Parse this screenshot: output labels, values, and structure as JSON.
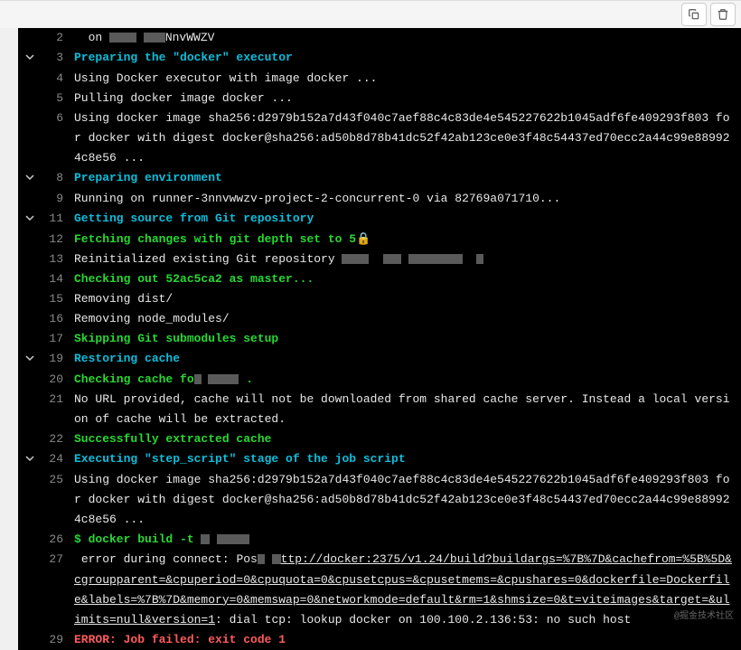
{
  "toolbar": {
    "copy_icon": "copy",
    "delete_icon": "delete"
  },
  "lines": [
    {
      "num": "2",
      "chevron": false,
      "segments": [
        {
          "text": "  on ",
          "cls": "white"
        },
        {
          "redacted": 30
        },
        {
          "text": " ",
          "cls": ""
        },
        {
          "redacted": 24
        },
        {
          "text": "NnvWWZV",
          "cls": "white"
        }
      ]
    },
    {
      "num": "3",
      "chevron": true,
      "segments": [
        {
          "text": "Preparing the \"docker\" executor",
          "cls": "cyan"
        }
      ]
    },
    {
      "num": "4",
      "chevron": false,
      "segments": [
        {
          "text": "Using Docker executor with image docker ...",
          "cls": "white"
        }
      ]
    },
    {
      "num": "5",
      "chevron": false,
      "segments": [
        {
          "text": "Pulling docker image docker ...",
          "cls": "white"
        }
      ]
    },
    {
      "num": "6",
      "chevron": false,
      "segments": [
        {
          "text": "Using docker image sha256:d2979b152a7d43f040c7aef88c4c83de4e545227622b1045adf6fe409293f803 for docker with digest docker@sha256:ad50b8d78b41dc52f42ab123ce0e3f48c54437ed70ecc2a44c99e889924c8e56 ...",
          "cls": "white"
        }
      ]
    },
    {
      "num": "8",
      "chevron": true,
      "segments": [
        {
          "text": "Preparing environment",
          "cls": "cyan"
        }
      ]
    },
    {
      "num": "9",
      "chevron": false,
      "segments": [
        {
          "text": "Running on runner-3nnvwwzv-project-2-concurrent-0 via 82769a071710...",
          "cls": "white"
        }
      ]
    },
    {
      "num": "11",
      "chevron": true,
      "segments": [
        {
          "text": "Getting source from Git repository",
          "cls": "cyan"
        }
      ]
    },
    {
      "num": "12",
      "chevron": false,
      "segments": [
        {
          "text": "Fetching changes with git depth set to 5",
          "cls": "green"
        },
        {
          "text": "🔒",
          "cls": "green"
        }
      ]
    },
    {
      "num": "13",
      "chevron": false,
      "segments": [
        {
          "text": "Reinitialized existing Git repository ",
          "cls": "white"
        },
        {
          "redacted": 30
        },
        {
          "text": "  ",
          "cls": ""
        },
        {
          "redacted": 20
        },
        {
          "text": " ",
          "cls": ""
        },
        {
          "redacted": 60
        },
        {
          "text": "  ",
          "cls": ""
        },
        {
          "redacted": 8
        }
      ]
    },
    {
      "num": "14",
      "chevron": false,
      "segments": [
        {
          "text": "Checking out 52ac5ca2 as master...",
          "cls": "green"
        }
      ]
    },
    {
      "num": "15",
      "chevron": false,
      "segments": [
        {
          "text": "Removing dist/",
          "cls": "white"
        }
      ]
    },
    {
      "num": "16",
      "chevron": false,
      "segments": [
        {
          "text": "Removing node_modules/",
          "cls": "white"
        }
      ]
    },
    {
      "num": "17",
      "chevron": false,
      "segments": [
        {
          "text": "Skipping Git submodules setup",
          "cls": "green"
        }
      ]
    },
    {
      "num": "19",
      "chevron": true,
      "segments": [
        {
          "text": "Restoring cache",
          "cls": "cyan"
        }
      ]
    },
    {
      "num": "20",
      "chevron": false,
      "segments": [
        {
          "text": "Checking cache fo",
          "cls": "green"
        },
        {
          "redacted": 8
        },
        {
          "text": " ",
          "cls": ""
        },
        {
          "redacted": 34
        },
        {
          "text": " .",
          "cls": "green"
        }
      ]
    },
    {
      "num": "21",
      "chevron": false,
      "segments": [
        {
          "text": "No URL provided, cache will not be downloaded from shared cache server. Instead a local version of cache will be extracted.",
          "cls": "white"
        }
      ]
    },
    {
      "num": "22",
      "chevron": false,
      "segments": [
        {
          "text": "Successfully extracted cache",
          "cls": "green"
        }
      ]
    },
    {
      "num": "24",
      "chevron": true,
      "segments": [
        {
          "text": "Executing \"step_script\" stage of the job script",
          "cls": "cyan"
        }
      ]
    },
    {
      "num": "25",
      "chevron": false,
      "segments": [
        {
          "text": "Using docker image sha256:d2979b152a7d43f040c7aef88c4c83de4e545227622b1045adf6fe409293f803 for docker with digest docker@sha256:ad50b8d78b41dc52f42ab123ce0e3f48c54437ed70ecc2a44c99e889924c8e56 ...",
          "cls": "white"
        }
      ]
    },
    {
      "num": "26",
      "chevron": false,
      "segments": [
        {
          "text": "$ docker build -t ",
          "cls": "green"
        },
        {
          "redacted": 10
        },
        {
          "text": " ",
          "cls": ""
        },
        {
          "redacted": 36
        }
      ]
    },
    {
      "num": "27",
      "chevron": false,
      "segments": [
        {
          "text": " error during connect: Pos",
          "cls": "white"
        },
        {
          "redacted": 8
        },
        {
          "text": " ",
          "cls": ""
        },
        {
          "redacted": 10
        },
        {
          "text": "ttp://docker:2375/v1.24/build?buildargs=%7B%7D&cachefrom=%5B%5D&cgroupparent=&cpuperiod=0&cpuquota=0&cpusetcpus=&cpusetmems=&cpushares=0&dockerfile=Dockerfile&labels=%7B%7D&memory=0&memswap=0&networkmode=default&rm=1&shmsize=0&t=viteimages&target=&ulimits=null&version=1",
          "cls": "white underline"
        },
        {
          "text": ": dial tcp: lookup docker on 100.100.2.136:53: no such host",
          "cls": "white"
        }
      ]
    },
    {
      "num": "29",
      "chevron": false,
      "segments": [
        {
          "text": "ERROR: Job failed: exit code 1",
          "cls": "red"
        }
      ]
    }
  ],
  "watermark": "@掘金技术社区"
}
